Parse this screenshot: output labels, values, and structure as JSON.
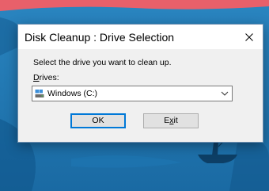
{
  "dialog": {
    "title": "Disk Cleanup : Drive Selection",
    "prompt": "Select the drive you want to clean up.",
    "drives_label_accel": "D",
    "drives_label_rest": "rives:",
    "selected_drive": "Windows (C:)",
    "ok_label": "OK",
    "exit_label_accel": "x",
    "exit_label_pre": "E",
    "exit_label_post": "it"
  },
  "icons": {
    "close": "close-icon",
    "drive": "hard-drive-icon",
    "dropdown": "chevron-down-icon"
  },
  "colors": {
    "dialog_bg": "#f0f0f0",
    "titlebar_bg": "#ffffff",
    "focus_border": "#0078d7",
    "wallpaper_sky": "#1a6fa8",
    "wallpaper_sunset": "#e8606a"
  }
}
